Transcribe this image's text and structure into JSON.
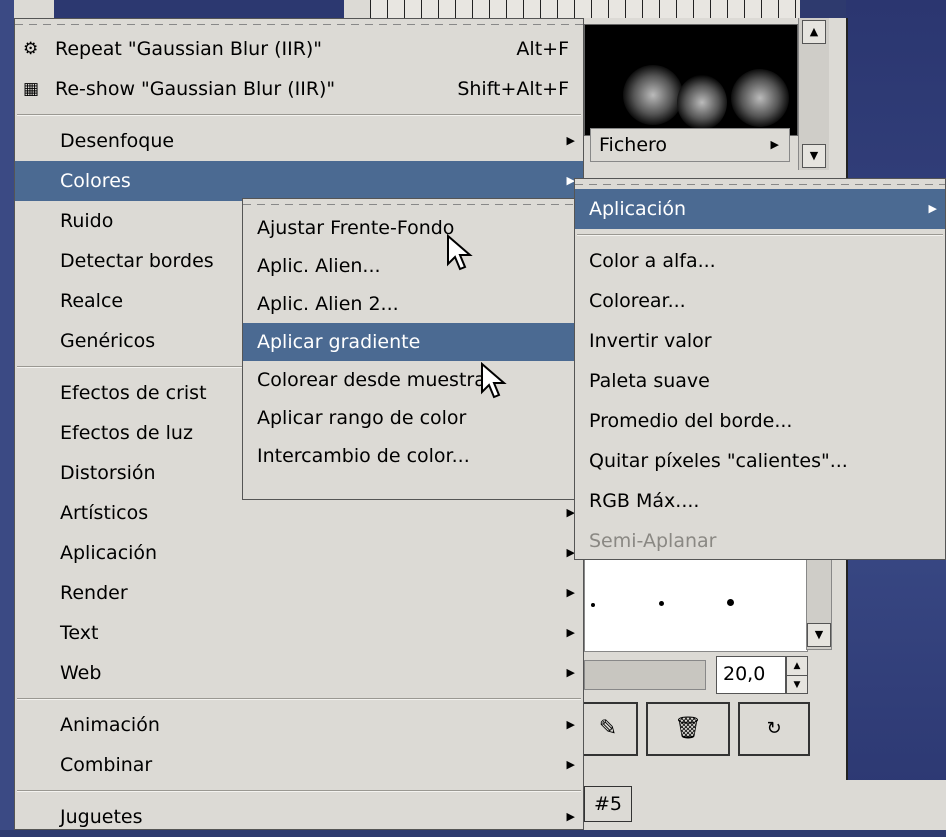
{
  "main_menu": {
    "repeat": {
      "label": "Repeat \"Gaussian Blur (IIR)\"",
      "accel": "Alt+F"
    },
    "reshow": {
      "label": "Re-show \"Gaussian Blur (IIR)\"",
      "accel": "Shift+Alt+F"
    },
    "groups": [
      [
        "Desenfoque",
        "Colores",
        "Ruido",
        "Detectar bordes",
        "Realce",
        "Genéricos"
      ],
      [
        "Efectos de crist",
        "Efectos de luz",
        "Distorsión",
        "Artísticos",
        "Aplicación",
        "Render",
        "Text",
        "Web"
      ],
      [
        "Animación",
        "Combinar"
      ],
      [
        "Juguetes"
      ]
    ],
    "highlighted": "Colores"
  },
  "colores_submenu": {
    "items": [
      "Ajustar Frente-Fondo",
      "Aplic. Alien...",
      "Aplic. Alien 2...",
      "Aplicar gradiente",
      "Colorear desde muestra",
      "Aplicar rango de color",
      "Intercambio de color..."
    ],
    "highlighted": "Aplicar gradiente"
  },
  "aplicacion_submenu": {
    "header": "Aplicación",
    "items": [
      "Color a alfa...",
      "Colorear...",
      "Invertir valor",
      "Paleta suave",
      "Promedio del borde...",
      "Quitar píxeles \"calientes\"...",
      "RGB Máx....",
      "Semi-Aplanar"
    ],
    "disabled": "Semi-Aplanar"
  },
  "background": {
    "fichero_label": "Fichero",
    "spin_value": "20,0",
    "tab_label": "#5"
  },
  "colors": {
    "menu_bg": "#dcdad5",
    "highlight": "#4b6a92",
    "desktop": "#2e3a6e"
  },
  "icons": [
    "gear-icon",
    "calendar-icon",
    "edit-icon",
    "trash-icon",
    "refresh-icon",
    "submenu-arrow-icon",
    "mouse-cursor-icon"
  ]
}
